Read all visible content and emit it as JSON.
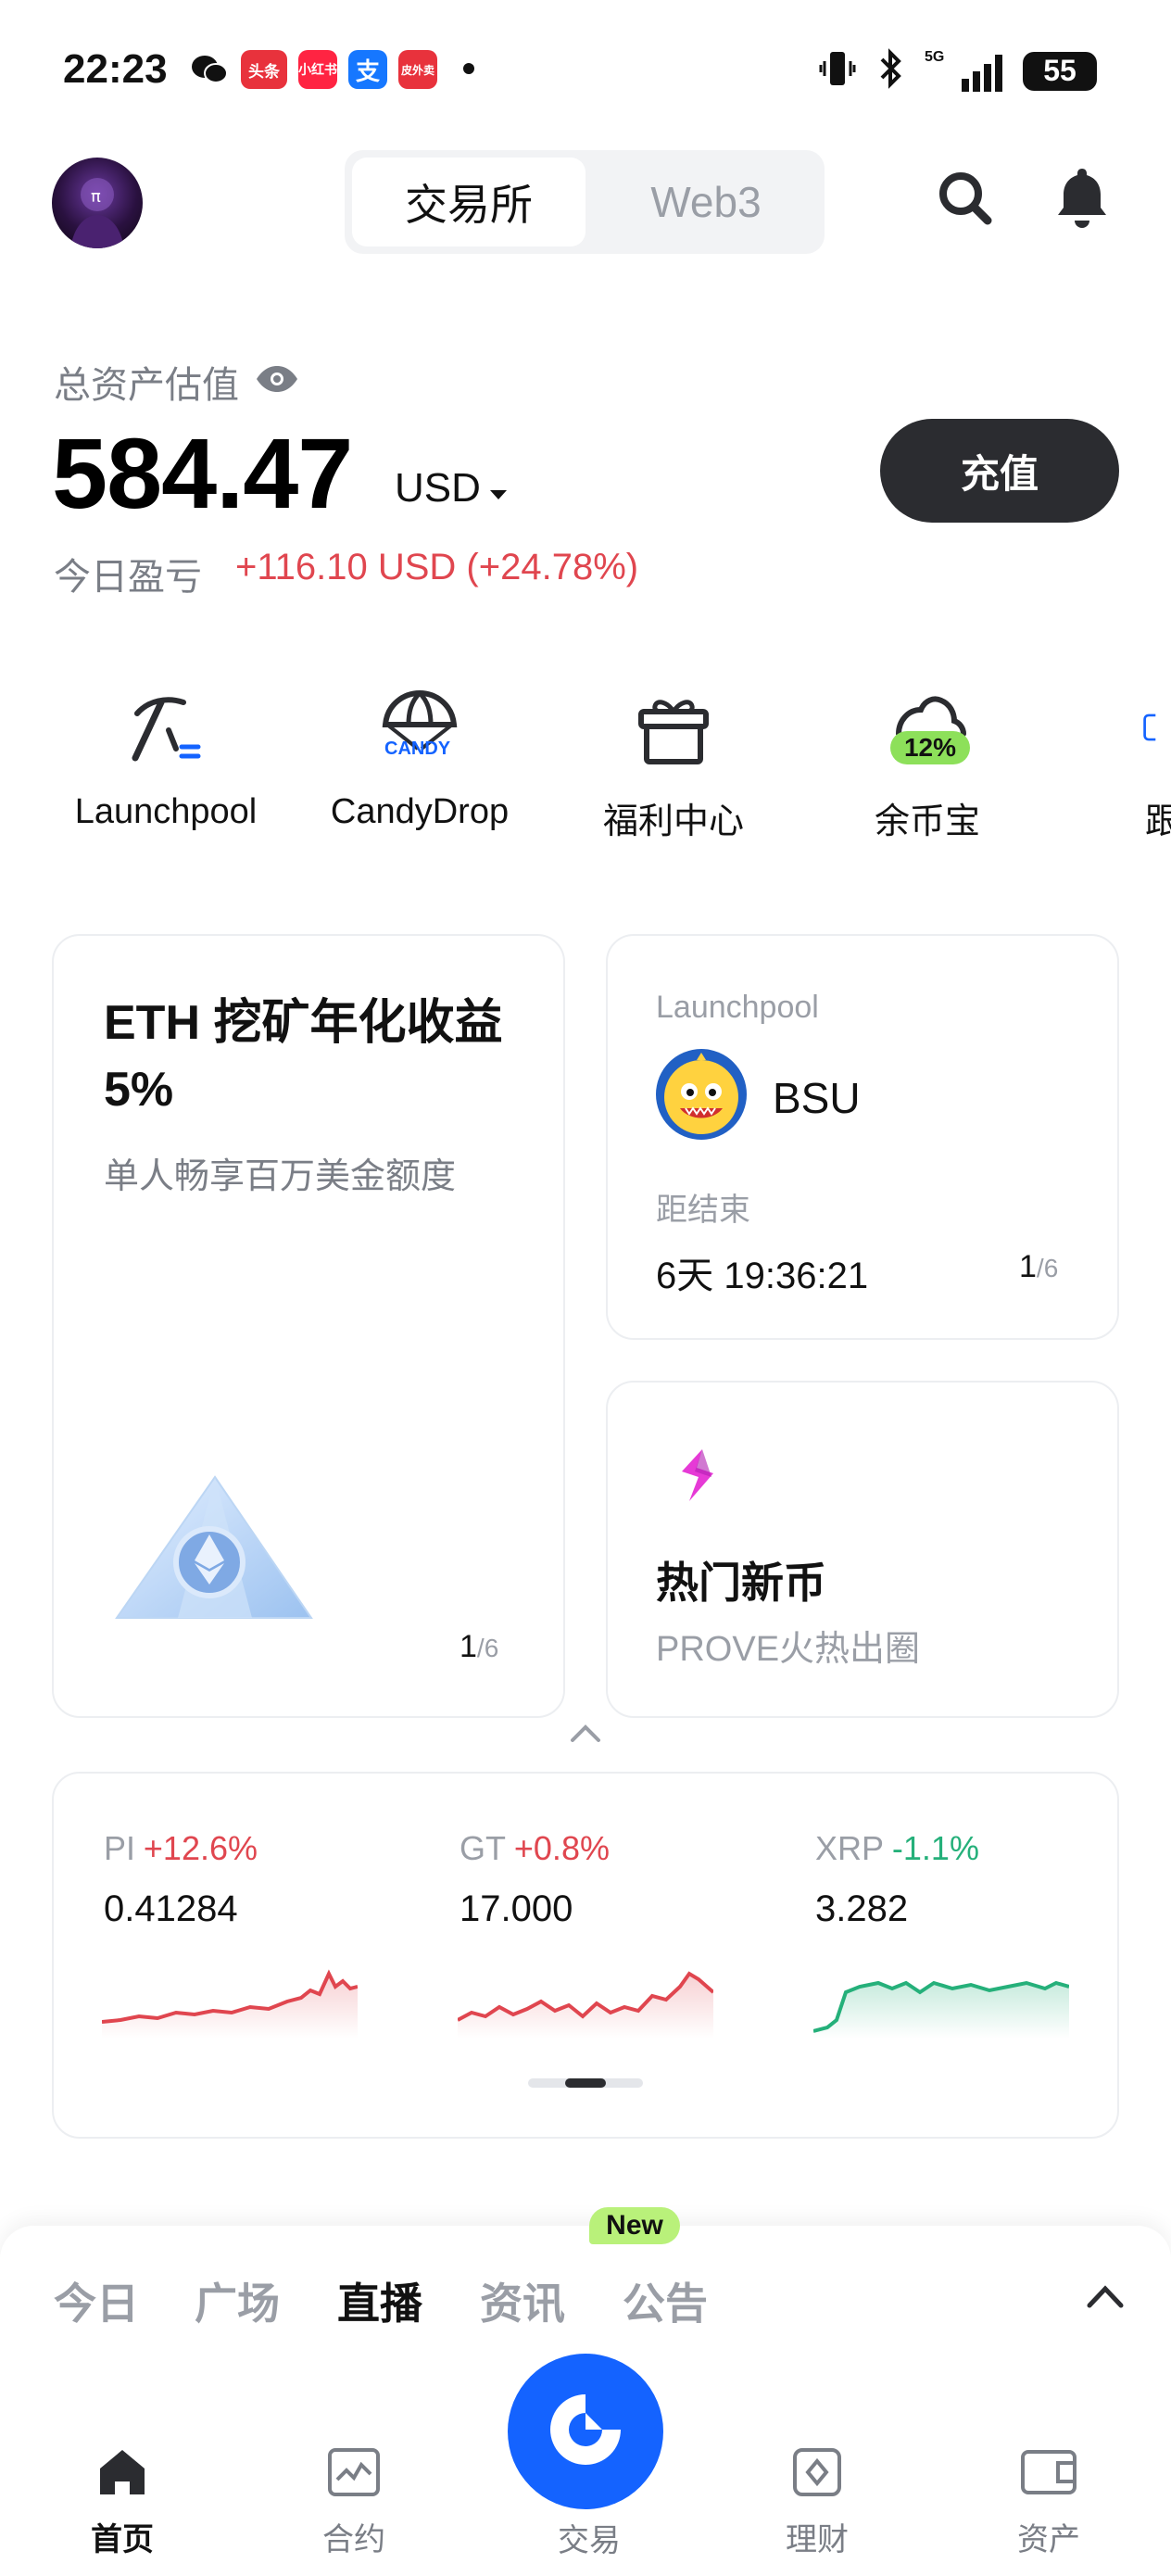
{
  "status_bar": {
    "time": "22:23",
    "apps": [
      "头条",
      "小红书",
      "支",
      "皮外卖"
    ],
    "network": "5G",
    "battery": "55"
  },
  "header": {
    "tabs": [
      {
        "label": "交易所",
        "active": true
      },
      {
        "label": "Web3",
        "active": false
      }
    ],
    "icons": [
      "search-icon",
      "bell-icon"
    ]
  },
  "assets": {
    "label": "总资产估值",
    "value": "584.47",
    "unit": "USD",
    "deposit_label": "充值",
    "pnl_label": "今日盈亏",
    "pnl_value": "+116.10 USD (+24.78%)"
  },
  "quick_menu": [
    {
      "label": "Launchpool",
      "icon": "pickaxe-icon"
    },
    {
      "label": "CandyDrop",
      "icon": "candy-parachute-icon",
      "badge": "CANDY"
    },
    {
      "label": "福利中心",
      "icon": "gift-icon"
    },
    {
      "label": "余币宝",
      "icon": "cloud-icon",
      "badge": "12%"
    },
    {
      "label": "跟",
      "icon": "copy-trade-icon"
    }
  ],
  "cards": {
    "eth": {
      "title_line1": "ETH 挖矿年化收益",
      "title_line2": "5%",
      "subtitle": "单人畅享百万美金额度",
      "pager_current": "1",
      "pager_total": "/6"
    },
    "launchpool": {
      "label": "Launchpool",
      "token": "BSU",
      "countdown_label": "距结束",
      "countdown": "6天 19:36:21",
      "pager_current": "1",
      "pager_total": "/6"
    },
    "hot": {
      "title": "热门新币",
      "subtitle": "PROVE火热出圈"
    }
  },
  "tickers": [
    {
      "symbol": "PI",
      "change": "+12.6%",
      "price": "0.41284",
      "direction": "up"
    },
    {
      "symbol": "GT",
      "change": "+0.8%",
      "price": "17.000",
      "direction": "up"
    },
    {
      "symbol": "XRP",
      "change": "-1.1%",
      "price": "3.282",
      "direction": "down"
    }
  ],
  "feed_tabs": [
    {
      "label": "今日",
      "active": false
    },
    {
      "label": "广场",
      "active": false
    },
    {
      "label": "直播",
      "active": true
    },
    {
      "label": "资讯",
      "active": false
    },
    {
      "label": "公告",
      "active": false
    }
  ],
  "new_badge": "New",
  "bottom_nav": [
    {
      "label": "首页",
      "active": true
    },
    {
      "label": "合约",
      "active": false
    },
    {
      "label": "交易",
      "active": false
    },
    {
      "label": "理财",
      "active": false
    },
    {
      "label": "资产",
      "active": false
    }
  ],
  "colors": {
    "up": "#e0464f",
    "down": "#25b07a",
    "brand": "#1463ff",
    "deposit_bg": "#2b2c30"
  }
}
